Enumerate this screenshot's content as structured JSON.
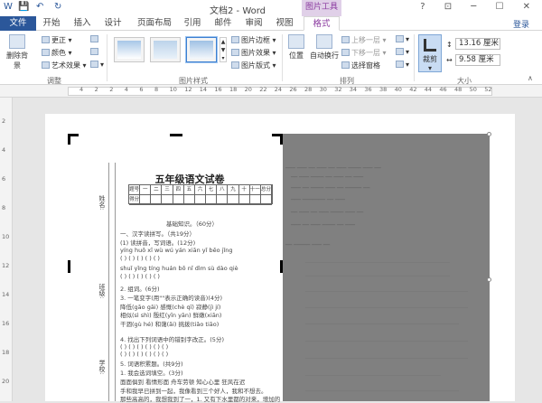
{
  "titlebar": {
    "title": "文档2 - Word",
    "context_tab_group": "图片工具",
    "window_controls": "? ⊡ ─ ☐ ✕",
    "qat": {
      "save": "💾",
      "undo": "↶",
      "redo": "↻"
    }
  },
  "tabs": [
    "文件",
    "开始",
    "插入",
    "设计",
    "页面布局",
    "引用",
    "邮件",
    "审阅",
    "视图",
    "格式"
  ],
  "login": "登录",
  "ribbon": {
    "adjust": {
      "remove_bg": "删除背景",
      "correct": "更正",
      "color": "颜色",
      "artistic": "艺术效果",
      "label": "调整"
    },
    "picture_styles": {
      "border": "图片边框",
      "effects": "图片效果",
      "layout": "图片版式",
      "label": "图片样式"
    },
    "arrange": {
      "position": "位置",
      "wrap": "自动换行",
      "bring_forward": "上移一层",
      "send_backward": "下移一层",
      "selection_pane": "选择窗格",
      "label": "排列"
    },
    "size": {
      "crop": "裁剪",
      "height": "13.16 厘米",
      "width": "9.58 厘米",
      "label": "大小"
    }
  },
  "ruler": {
    "h_ticks": [
      "4",
      "2",
      "2",
      "4",
      "6",
      "8",
      "10",
      "12",
      "14",
      "16",
      "18",
      "20",
      "22",
      "24",
      "26",
      "28",
      "30",
      "32",
      "34",
      "36",
      "38",
      "40",
      "42",
      "44",
      "46",
      "48",
      "50",
      "52"
    ],
    "v_ticks": [
      "2",
      "4",
      "6",
      "8",
      "10",
      "12",
      "14",
      "16",
      "18",
      "20"
    ]
  },
  "exam": {
    "title": "五年级语文试卷",
    "side_labels": [
      "姓名:",
      "班级:",
      "学校:"
    ],
    "score_header": [
      "题号",
      "一",
      "二",
      "三",
      "四",
      "五",
      "六",
      "七",
      "八",
      "九",
      "十",
      "十一",
      "总分"
    ],
    "score_row": [
      "得分"
    ],
    "section1": "基础知识。（60分）",
    "q1": "一、汉字读拼写。（共19分）",
    "q1a": "(1) 读拼音，写词语。(12分)",
    "pinyin1": "yíng huǒ   xī  wù   wú  yán   xiān  yǐ   bēo  jǐng",
    "pinyin2": "shuǐ yǐng  tíng huán  bō  nǐ   dìm  sù   dào qiè",
    "q2": "2. 组词。(6分)",
    "q3": "3. 一笔变字(用\"\"表示正确的读音)(4分)",
    "q4": "4. 找出下列词语中的错别字改正。(5分)",
    "q5": "5. 词语积累题。(共9分)",
    "q5a": "1. 我会选词填空。(3分)",
    "q5b": "面面俱到  看情形面  舟车劳顿  知心心里  狂风在迟",
    "q5c": "手和我早已拼到一起，我像看到三个好人，我和不想去。",
    "q5d": "那些高高的，我想我到了一，1. 又有下水里都的对来，增加的"
  }
}
